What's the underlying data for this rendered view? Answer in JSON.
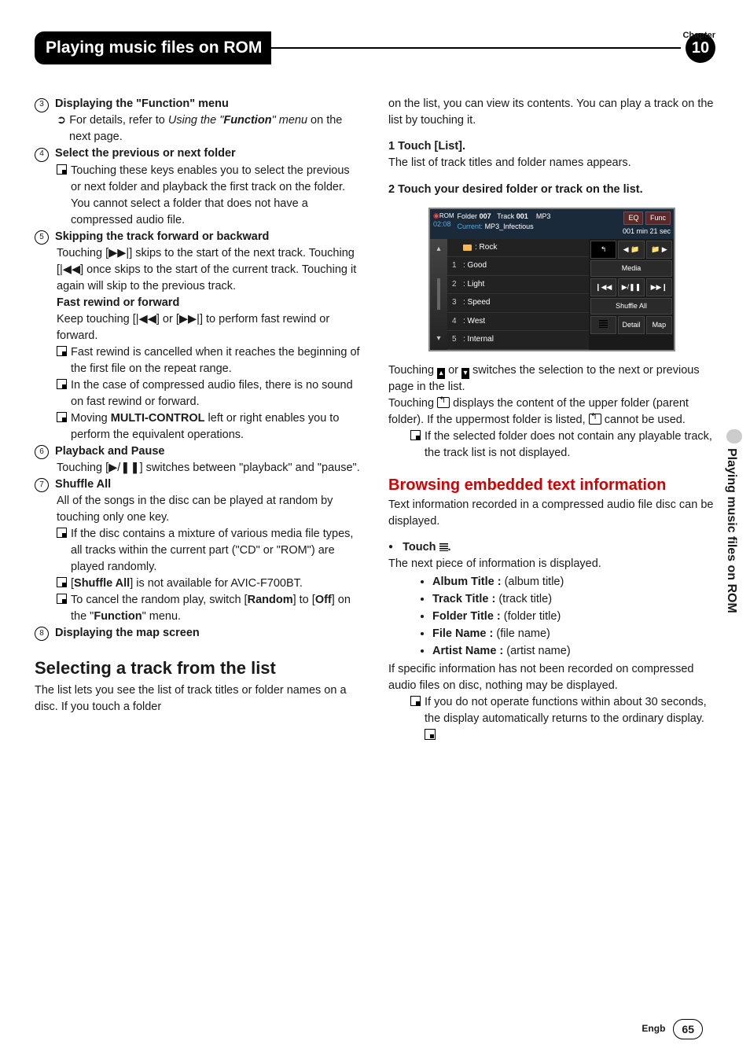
{
  "chapter_label": "Chapter",
  "chapter_number": "10",
  "page_title": "Playing music files on ROM",
  "side_tab": "Playing music files on ROM",
  "left": {
    "i3_head": "Displaying the \"Function\" menu",
    "i3_sub_pre": "For details, refer to ",
    "i3_sub_ital": "Using the \"",
    "i3_sub_bold": "Function",
    "i3_sub_ital2": "\" menu",
    "i3_sub_post": " on the next page.",
    "i4_head": "Select the previous or next folder",
    "i4_b1": "Touching these keys enables you to select the previous or next folder and playback the first track on the folder. You cannot select a folder that does not have a compressed audio file.",
    "i5_head": "Skipping the track forward or backward",
    "i5_p1a": "Touching [",
    "i5_p1b": "] skips to the start of the next track. Touching [",
    "i5_p1c": "] once skips to the start of the current track. Touching it again will skip to the previous track.",
    "i5_sub_head": "Fast rewind or forward",
    "i5_p2a": "Keep touching [",
    "i5_p2b": "] or [",
    "i5_p2c": "] to perform fast rewind or forward.",
    "i5_b1": "Fast rewind is cancelled when it reaches the beginning of the first file on the repeat range.",
    "i5_b2": "In the case of compressed audio files, there is no sound on fast rewind or forward.",
    "i5_b3a": "Moving ",
    "i5_b3b": "MULTI-CONTROL",
    "i5_b3c": " left or right enables you to perform the equivalent operations.",
    "i6_head": "Playback and Pause",
    "i6_p1a": "Touching [",
    "i6_p1b": "] switches between \"playback\" and \"pause\".",
    "i7_head": "Shuffle All",
    "i7_p1": "All of the songs in the disc can be played at random by touching only one key.",
    "i7_b1": "If the disc contains a mixture of various media file types, all tracks within the current part (\"CD\" or \"ROM\") are played randomly.",
    "i7_b2a": "[",
    "i7_b2b": "Shuffle All",
    "i7_b2c": "] is not available for AVIC-F700BT.",
    "i7_b3a": "To cancel the random play, switch [",
    "i7_b3b": "Random",
    "i7_b3c": "] to [",
    "i7_b3d": "Off",
    "i7_b3e": "] on the \"",
    "i7_b3f": "Function",
    "i7_b3g": "\" menu.",
    "i8_head": "Displaying the map screen",
    "sel_head": "Selecting a track from the list",
    "sel_p1": "The list lets you see the list of track titles or folder names on a disc. If you touch a folder"
  },
  "right": {
    "cont": "on the list, you can view its contents. You can play a track on the list by touching it.",
    "s1_head": "1    Touch [List].",
    "s1_p": "The list of track titles and folder names appears.",
    "s2_head": "2    Touch your desired folder or track on the list.",
    "after1a": "Touching ",
    "after1b": " or ",
    "after1c": " switches the selection to the next or previous page in the list.",
    "after2a": "Touching ",
    "after2b": " displays the content of the upper folder (parent folder). If the uppermost folder is listed, ",
    "after2c": " cannot be used.",
    "after_b1": "If the selected folder does not contain any playable track, the track list is not displayed.",
    "browse_head": "Browsing embedded text information",
    "browse_p1": "Text information recorded in a compressed audio file disc can be displayed.",
    "touch_head": "Touch ",
    "touch_head_post": ".",
    "touch_p1": "The next piece of information is displayed.",
    "info_items": [
      {
        "label": "Album Title :",
        "desc": " (album title)"
      },
      {
        "label": "Track Title :",
        "desc": " (track title)"
      },
      {
        "label": "Folder Title :",
        "desc": " (folder title)"
      },
      {
        "label": "File Name :",
        "desc": " (file name)"
      },
      {
        "label": "Artist Name :",
        "desc": " (artist name)"
      }
    ],
    "tail_p1": "If specific information has not been recorded on compressed audio files on disc, nothing may be displayed.",
    "tail_b1": "If you do not operate functions within about 30 seconds, the display automatically returns to the ordinary display."
  },
  "screenshot": {
    "rom_label": "ROM",
    "time": "02:08",
    "folder_label": "Folder",
    "folder_val": "007",
    "track_label": "Track",
    "track_val": "001",
    "format": "MP3",
    "eq": "EQ",
    "func": "Func",
    "current_label": "Current:",
    "current_val": "MP3_Infectious",
    "counter": "001 min 21 sec",
    "rows": [
      {
        "idx": "",
        "label": ": Rock",
        "folder": true
      },
      {
        "idx": "1",
        "label": ": Good"
      },
      {
        "idx": "2",
        "label": ": Light"
      },
      {
        "idx": "3",
        "label": ": Speed"
      },
      {
        "idx": "4",
        "label": ": West"
      },
      {
        "idx": "5",
        "label": ": Internal"
      }
    ],
    "media": "Media",
    "shuffle": "Shuffle All",
    "detail": "Detail",
    "map": "Map"
  },
  "footer": {
    "lang": "Engb",
    "page": "65"
  }
}
